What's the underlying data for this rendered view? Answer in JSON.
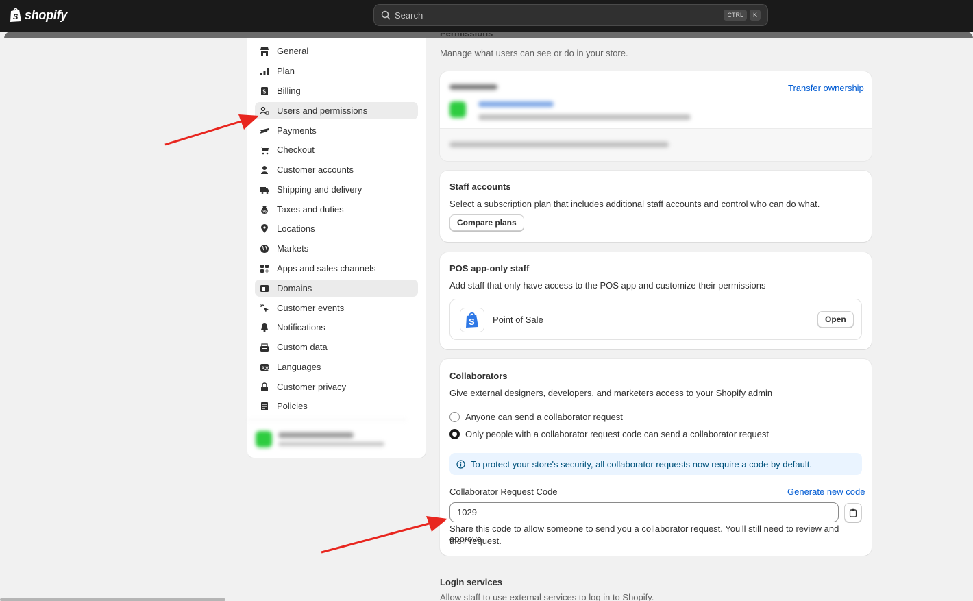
{
  "header": {
    "logo_text": "shopify",
    "search_placeholder": "Search",
    "shortcut_keys": [
      "CTRL",
      "K"
    ]
  },
  "sidebar": {
    "items": [
      {
        "label": "General",
        "icon": "store-icon"
      },
      {
        "label": "Plan",
        "icon": "plan-chart-icon"
      },
      {
        "label": "Billing",
        "icon": "billing-icon"
      },
      {
        "label": "Users and permissions",
        "icon": "users-icon",
        "active": true
      },
      {
        "label": "Payments",
        "icon": "payments-icon"
      },
      {
        "label": "Checkout",
        "icon": "cart-icon"
      },
      {
        "label": "Customer accounts",
        "icon": "person-icon"
      },
      {
        "label": "Shipping and delivery",
        "icon": "truck-icon"
      },
      {
        "label": "Taxes and duties",
        "icon": "tax-icon"
      },
      {
        "label": "Locations",
        "icon": "location-icon"
      },
      {
        "label": "Markets",
        "icon": "globe-icon"
      },
      {
        "label": "Apps and sales channels",
        "icon": "apps-icon"
      },
      {
        "label": "Domains",
        "icon": "domains-icon",
        "hover": true
      },
      {
        "label": "Customer events",
        "icon": "cursor-icon"
      },
      {
        "label": "Notifications",
        "icon": "bell-icon"
      },
      {
        "label": "Custom data",
        "icon": "custom-data-icon"
      },
      {
        "label": "Languages",
        "icon": "language-icon"
      },
      {
        "label": "Customer privacy",
        "icon": "lock-icon"
      },
      {
        "label": "Policies",
        "icon": "policies-icon"
      }
    ]
  },
  "permissions": {
    "title": "Permissions",
    "subtitle": "Manage what users can see or do in your store.",
    "transfer_link": "Transfer ownership"
  },
  "staff_accounts": {
    "title": "Staff accounts",
    "description": "Select a subscription plan that includes additional staff accounts and control who can do what.",
    "button": "Compare plans"
  },
  "pos_staff": {
    "title": "POS app-only staff",
    "description": "Add staff that only have access to the POS app and customize their permissions",
    "app_name": "Point of Sale",
    "button": "Open"
  },
  "collaborators": {
    "title": "Collaborators",
    "description": "Give external designers, developers, and marketers access to your Shopify admin",
    "options": [
      {
        "label": "Anyone can send a collaborator request",
        "selected": false
      },
      {
        "label": "Only people with a collaborator request code can send a collaborator request",
        "selected": true
      }
    ],
    "banner": "To protect your store's security, all collaborator requests now require a code by default.",
    "code_label": "Collaborator Request Code",
    "generate_link": "Generate new code",
    "code_value": "1029",
    "help_text_1": "Share this code to allow someone to send you a collaborator request. You'll still need to review and approve",
    "help_text_2": "their request."
  },
  "login_services": {
    "title": "Login services",
    "subtitle": "Allow staff to use external services to log in to Shopify."
  },
  "colors": {
    "accent_link": "#005bd3",
    "annotation_arrow": "#e8261f",
    "topbar": "#1a1a1a"
  }
}
